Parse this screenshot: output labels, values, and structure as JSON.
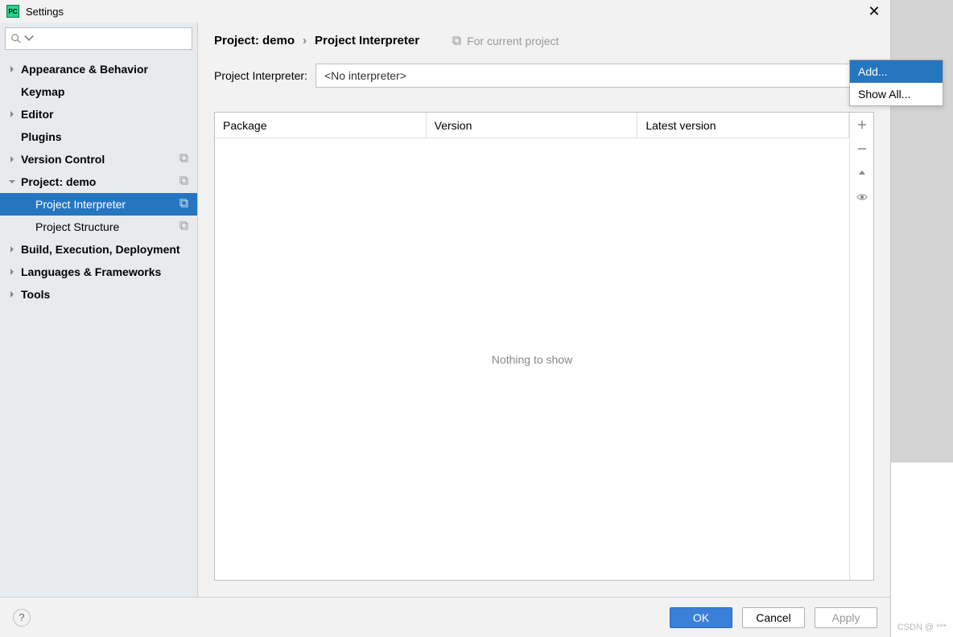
{
  "title": "Settings",
  "search_placeholder": "",
  "sidebar": {
    "items": [
      {
        "label": "Appearance & Behavior",
        "arrow": "right",
        "copy": false
      },
      {
        "label": "Keymap",
        "arrow": "none",
        "copy": false
      },
      {
        "label": "Editor",
        "arrow": "right",
        "copy": false
      },
      {
        "label": "Plugins",
        "arrow": "none",
        "copy": false
      },
      {
        "label": "Version Control",
        "arrow": "right",
        "copy": true
      },
      {
        "label": "Project: demo",
        "arrow": "down",
        "copy": true
      },
      {
        "label": "Project Interpreter",
        "arrow": "child",
        "copy": true,
        "selected": true
      },
      {
        "label": "Project Structure",
        "arrow": "child",
        "copy": true
      },
      {
        "label": "Build, Execution, Deployment",
        "arrow": "right",
        "copy": false
      },
      {
        "label": "Languages & Frameworks",
        "arrow": "right",
        "copy": false
      },
      {
        "label": "Tools",
        "arrow": "right",
        "copy": false
      }
    ]
  },
  "breadcrumb": {
    "part1": "Project: demo",
    "sep": "›",
    "part2": "Project Interpreter",
    "hint": "For current project"
  },
  "interpreter": {
    "label": "Project Interpreter:",
    "value": "<No interpreter>"
  },
  "packages": {
    "columns": {
      "package": "Package",
      "version": "Version",
      "latest": "Latest version"
    },
    "empty_text": "Nothing to show"
  },
  "popup": {
    "add": "Add...",
    "show_all": "Show All..."
  },
  "footer": {
    "ok": "OK",
    "cancel": "Cancel",
    "apply": "Apply"
  },
  "watermark": "CSDN @ *** "
}
